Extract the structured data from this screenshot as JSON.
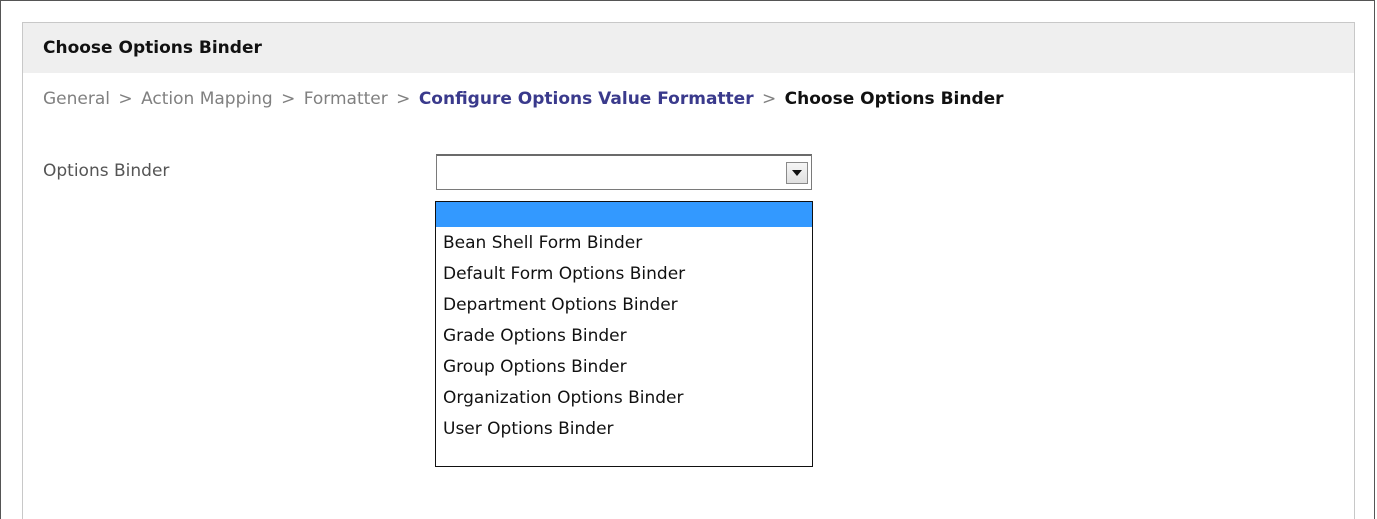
{
  "panel": {
    "title": "Choose Options Binder"
  },
  "breadcrumb": {
    "items": [
      {
        "label": "General",
        "kind": "plain"
      },
      {
        "label": "Action Mapping",
        "kind": "plain"
      },
      {
        "label": "Formatter",
        "kind": "plain"
      },
      {
        "label": "Configure Options Value Formatter",
        "kind": "link"
      },
      {
        "label": "Choose Options Binder",
        "kind": "current"
      }
    ],
    "separator": ">"
  },
  "form": {
    "options_binder_label": "Options Binder",
    "options_binder_value": "",
    "dropdown_options": [
      "",
      "Bean Shell Form Binder",
      "Default Form Options Binder",
      "Department Options Binder",
      "Grade Options Binder",
      "Group Options Binder",
      "Organization Options Binder",
      "User Options Binder"
    ],
    "highlighted_index": 0
  },
  "icons": {
    "select_arrow": "chevron-down-icon"
  },
  "colors": {
    "link": "#3a3a8c",
    "highlight": "#3399ff",
    "header_bg": "#efefef"
  }
}
